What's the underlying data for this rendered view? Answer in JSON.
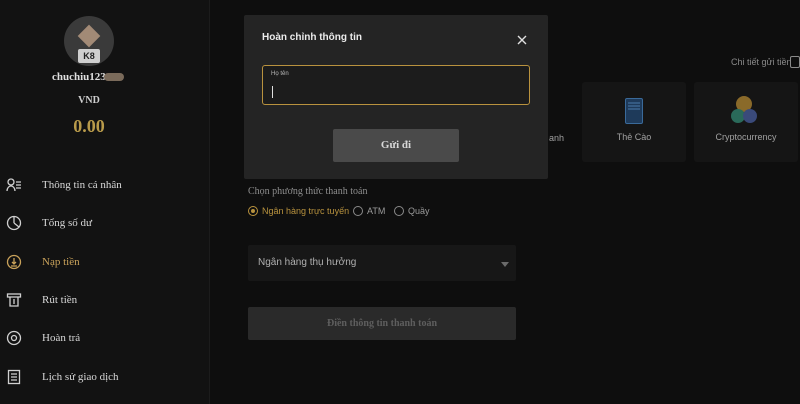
{
  "user": {
    "avatar_badge": "K8",
    "username": "chuchiu123",
    "currency": "VND",
    "balance": "0.00"
  },
  "sidebar": {
    "items": [
      {
        "label": "Thông tin cá nhân",
        "icon": "user-list-icon"
      },
      {
        "label": "Tổng số dư",
        "icon": "pie-chart-icon"
      },
      {
        "label": "Nạp tiền",
        "icon": "deposit-icon",
        "active": true
      },
      {
        "label": "Rút tiền",
        "icon": "withdraw-icon"
      },
      {
        "label": "Hoàn trả",
        "icon": "refund-icon"
      },
      {
        "label": "Lịch sử giao dịch",
        "icon": "history-icon"
      }
    ]
  },
  "main": {
    "deposit_details_link": "Chi tiết gửi tiền",
    "partial_method_label": "anh",
    "methods": [
      {
        "label": "Thẻ Cào",
        "icon": "card-icon"
      },
      {
        "label": "Cryptocurrency",
        "icon": "crypto-coins-icon"
      }
    ],
    "choose_method_label": "Chọn phương thức thanh toán",
    "payment_options": [
      {
        "label": "Ngân hàng trực tuyến",
        "selected": true
      },
      {
        "label": "ATM",
        "selected": false
      },
      {
        "label": "Quầy",
        "selected": false
      }
    ],
    "bank_select_placeholder": "Ngân hàng thụ hưởng",
    "fill_button": "Điền thông tin thanh toán"
  },
  "modal": {
    "title": "Hoàn chỉnh thông tin",
    "field_label": "Họ tên",
    "field_value": "",
    "submit_label": "Gửi đi"
  },
  "colors": {
    "accent": "#c9a25a",
    "background": "#0e0e0e",
    "modal": "#242424"
  }
}
